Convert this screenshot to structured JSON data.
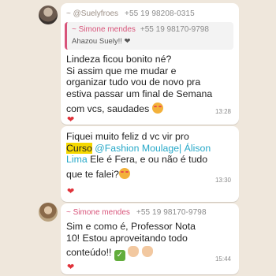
{
  "msg1": {
    "sender": "~ @Suelyfroes",
    "phone": "+55 19 98208-0315",
    "quote": {
      "sender": "~ Simone mendes",
      "phone": "+55 19 98170-9798",
      "text": "Ahazou Suely!! ❤"
    },
    "lines": [
      "Lindeza ficou bonito né?",
      "Si assim que me mudar e",
      "organizar tudo vou de novo pra",
      "estiva passar um final de Semana",
      "com vcs, saudades"
    ],
    "time": "13:28",
    "reaction": "❤"
  },
  "msg2": {
    "line1": "Fiquei muito feliz d vc vir pro",
    "highlight": "Curso",
    "link_part1": "@Fashion Moulage| Álison",
    "link_part2": "Lima",
    "line3_tail": "Ele é Fera, e ou não é tudo",
    "line4": "que te falei?",
    "time": "13:30",
    "reaction": "❤"
  },
  "msg3": {
    "sender": "~ Simone mendes",
    "phone": "+55 19 98170-9798",
    "lines": [
      "Sim e como é, Professor Nota",
      "10! Estou aproveitando todo",
      "conteúdo!!"
    ],
    "time": "15:44",
    "reaction": "❤"
  },
  "icons": [
    "smiling-face-icon",
    "check-mark-icon",
    "clapping-hands-icon",
    "heart-icon"
  ]
}
